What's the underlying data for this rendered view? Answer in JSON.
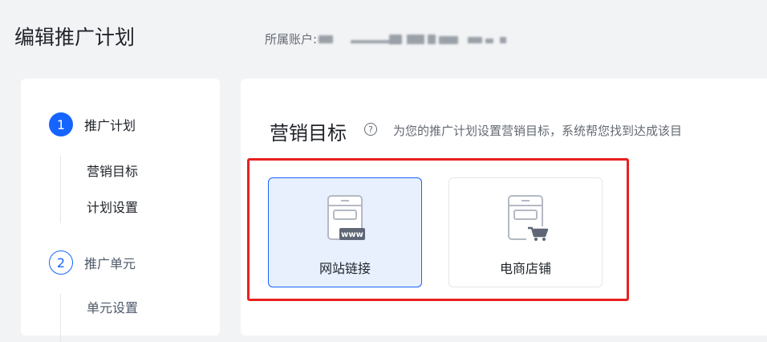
{
  "header": {
    "title": "编辑推广计划",
    "account_label": "所属账户:"
  },
  "sidebar": {
    "steps": [
      {
        "number": "1",
        "label": "推广计划",
        "active": true,
        "sub_items": [
          "营销目标",
          "计划设置"
        ]
      },
      {
        "number": "2",
        "label": "推广单元",
        "active": false,
        "sub_items": [
          "单元设置"
        ]
      }
    ]
  },
  "main": {
    "section_title": "营销目标",
    "help_symbol": "?",
    "description": "为您的推广计划设置营销目标，系统帮您找到达成该目",
    "targets": [
      {
        "label": "网站链接",
        "icon": "website-link-icon",
        "icon_badge": "www",
        "selected": true
      },
      {
        "label": "电商店铺",
        "icon": "ecommerce-shop-icon",
        "selected": false
      }
    ]
  },
  "colors": {
    "primary": "#1664ff",
    "selected_bg": "#e8effd",
    "highlight": "#e8211e",
    "background": "#f2f3f5"
  }
}
